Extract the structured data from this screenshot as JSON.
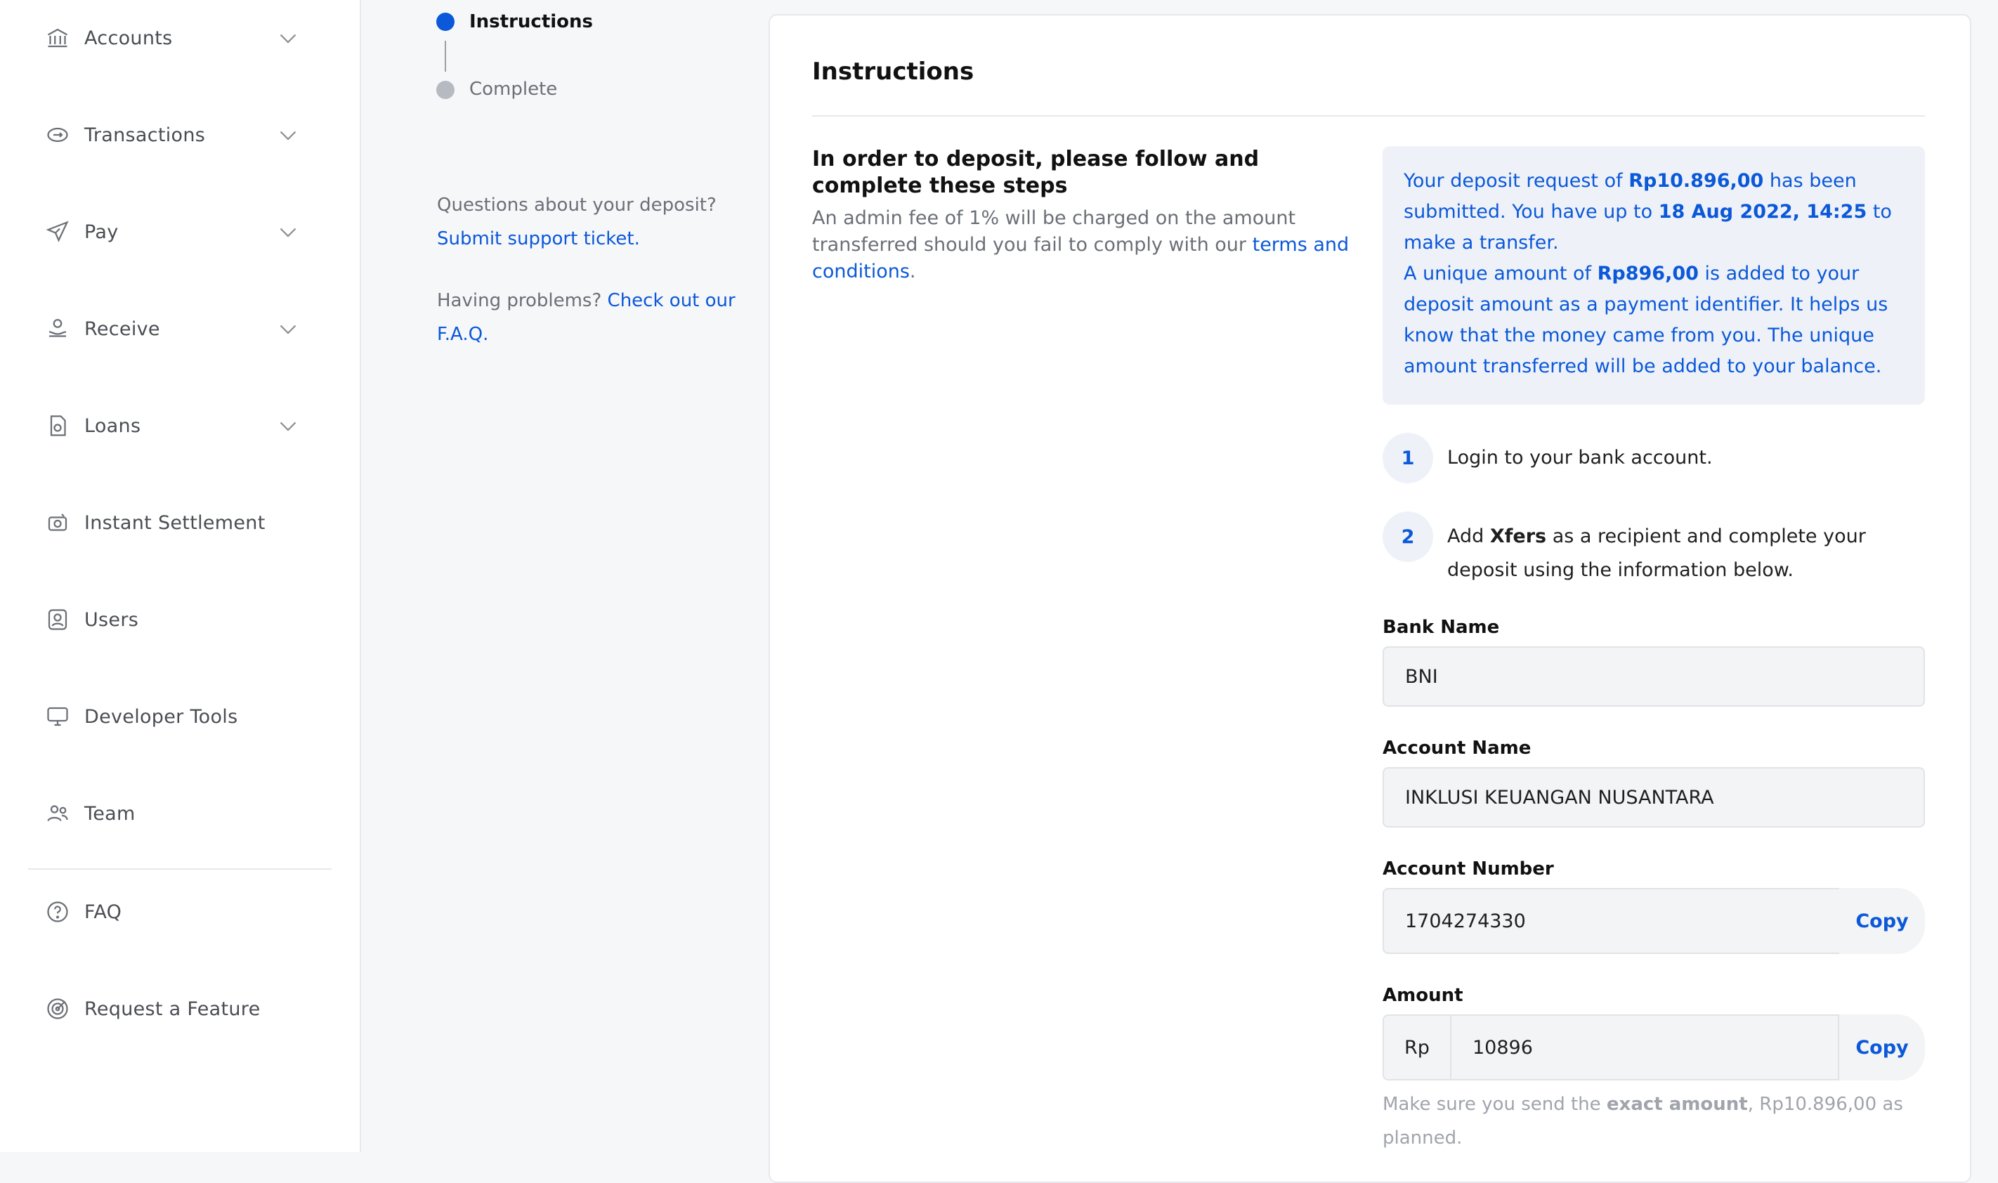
{
  "sidebar": {
    "items": [
      {
        "label": "Accounts",
        "icon": "bank-icon",
        "has_chevron": true
      },
      {
        "label": "Transactions",
        "icon": "transactions-icon",
        "has_chevron": true
      },
      {
        "label": "Pay",
        "icon": "send-icon",
        "has_chevron": true
      },
      {
        "label": "Receive",
        "icon": "receive-icon",
        "has_chevron": true
      },
      {
        "label": "Loans",
        "icon": "loans-icon",
        "has_chevron": true
      },
      {
        "label": "Instant Settlement",
        "icon": "instant-settlement-icon",
        "has_chevron": false
      },
      {
        "label": "Users",
        "icon": "users-icon",
        "has_chevron": false
      },
      {
        "label": "Developer Tools",
        "icon": "monitor-icon",
        "has_chevron": false
      },
      {
        "label": "Team",
        "icon": "team-icon",
        "has_chevron": false
      },
      {
        "label": "FAQ",
        "icon": "question-icon",
        "has_chevron": false
      },
      {
        "label": "Request a Feature",
        "icon": "target-icon",
        "has_chevron": false
      }
    ]
  },
  "stepper": {
    "steps": [
      {
        "label": "Instructions",
        "state": "active"
      },
      {
        "label": "Complete",
        "state": "pending"
      }
    ]
  },
  "help": {
    "question": "Questions about your deposit?",
    "support_link": "Submit support ticket.",
    "problems": "Having problems?",
    "faq_link": "Check out our F.A.Q."
  },
  "card": {
    "title": "Instructions",
    "lead_title": "In order to deposit, please follow and complete these steps",
    "lead_body": "An admin fee of 1% will be charged on the amount transferred should you fail to comply with our",
    "lead_link": "terms and conditions",
    "lead_end": ".",
    "info": {
      "p1_a": "Your deposit request of ",
      "p1_amount": "Rp10.896,00",
      "p1_b": " has been submitted. You have up to ",
      "p1_deadline": "18 Aug 2022, 14:25",
      "p1_c": " to make a transfer.",
      "p2_a": "A unique amount of ",
      "p2_amount": "Rp896,00",
      "p2_b": " is added to your deposit amount as a payment identifier. It helps us know that the money came from you. The unique amount transferred will be added to your balance."
    },
    "steps": [
      {
        "num": "1",
        "text": "Login to your bank account."
      },
      {
        "num": "2",
        "text_a": "Add ",
        "text_bold": "Xfers",
        "text_b": " as a recipient and complete your deposit using the information below."
      }
    ],
    "fields": {
      "bank_name_label": "Bank Name",
      "bank_name": "BNI",
      "account_name_label": "Account Name",
      "account_name": "INKLUSI KEUANGAN NUSANTARA",
      "account_number_label": "Account Number",
      "account_number": "1704274330",
      "amount_label": "Amount",
      "currency_prefix": "Rp",
      "amount": "10896",
      "copy_label": "Copy"
    },
    "note_a": "Make sure you send the ",
    "note_bold": "exact amount",
    "note_b": ", Rp10.896,00 as planned."
  },
  "colors": {
    "accent": "#0b58d9",
    "step_pending": "#b7bbc1",
    "info_bg": "#eef2f8"
  }
}
